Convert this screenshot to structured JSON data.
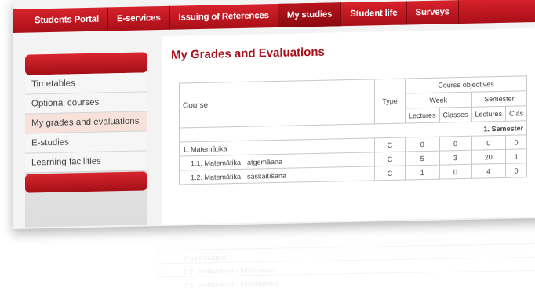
{
  "nav": {
    "items": [
      "Students Portal",
      "E-services",
      "Issuing of References",
      "My studies",
      "Student life",
      "Surveys"
    ],
    "active": "My studies"
  },
  "sidebar": {
    "items": [
      "Timetables",
      "Optional courses",
      "My grades and evaluations",
      "E-studies",
      "Learning facilities"
    ],
    "active": "My grades and evaluations"
  },
  "page": {
    "title": "My Grades and Evaluations"
  },
  "table": {
    "headers": {
      "course": "Course",
      "type": "Type",
      "objectives": "Course objectives",
      "week": "Week",
      "semester": "Semester",
      "lectures": "Lectures",
      "classes": "Classes",
      "semester_lectures": "Lectures",
      "semester_classes": "Clas"
    },
    "semester_label": "1. Semester",
    "rows": [
      {
        "course": "1. Matemātika",
        "type": "C",
        "week_lectures": "0",
        "week_classes": "0",
        "sem_lectures": "0",
        "sem_classes": "0"
      },
      {
        "course": "1.1. Matemātika - atgemāana",
        "type": "C",
        "week_lectures": "5",
        "week_classes": "3",
        "sem_lectures": "20",
        "sem_classes": "1"
      },
      {
        "course": "1.2. Matemātika - saskaitīšana",
        "type": "C",
        "week_lectures": "1",
        "week_classes": "0",
        "sem_lectures": "4",
        "sem_classes": "0"
      }
    ]
  },
  "colors": {
    "brand_red": "#c41a22",
    "title_red": "#a8111a",
    "active_item_bg": "#f6e2da"
  }
}
